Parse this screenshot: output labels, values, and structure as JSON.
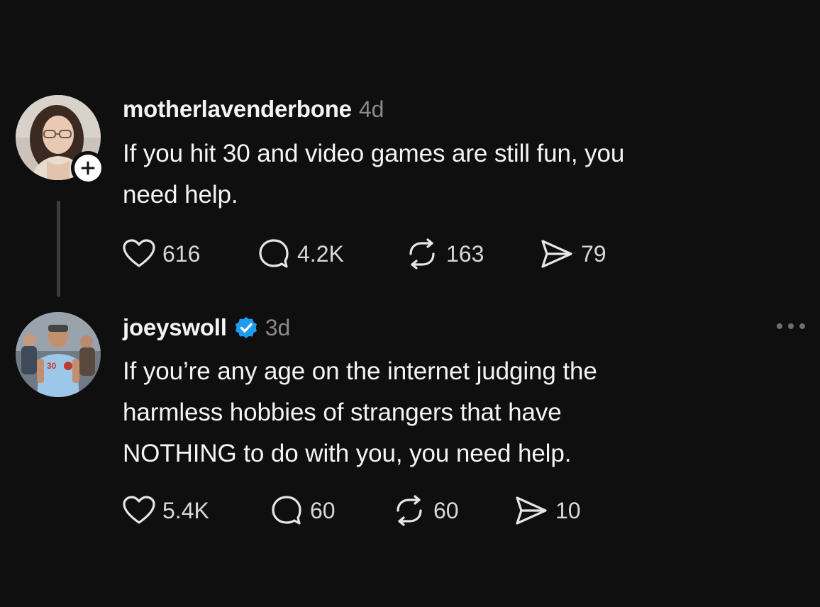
{
  "posts": [
    {
      "username": "motherlavenderbone",
      "time": "4d",
      "avatar": "profile-photo",
      "follow_icon": "plus-icon",
      "text_lines": [
        "If you hit 30 and video games are still fun, you",
        "need help."
      ],
      "likes": "616",
      "replies": "4.2K",
      "reposts": "163",
      "shares": "79"
    },
    {
      "username": "joeyswoll",
      "verified": true,
      "time": "3d",
      "avatar": "profile-photo",
      "text_lines": [
        "If you’re any age on the internet judging the",
        "harmless hobbies of strangers that have",
        "NOTHING to do with you, you need help."
      ],
      "likes": "5.4K",
      "replies": "60",
      "reposts": "60",
      "shares": "10"
    }
  ],
  "colors": {
    "background": "#0f0f0f",
    "text": "#f4f4f4",
    "muted": "#8a8a8a",
    "verified": "#1d9bf0"
  },
  "icons": {
    "like": "heart-icon",
    "reply": "comment-icon",
    "repost": "repost-icon",
    "share": "send-icon",
    "more": "more-options-icon"
  }
}
